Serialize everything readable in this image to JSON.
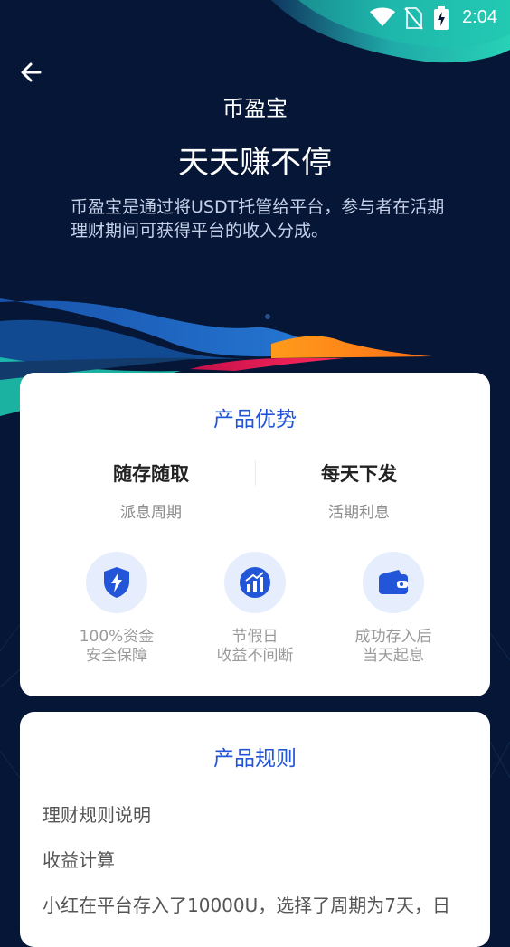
{
  "status_bar": {
    "time": "2:04"
  },
  "header": {
    "app_name": "币盈宝",
    "headline": "天天赚不停",
    "description": "币盈宝是通过将USDT托管给平台，参与者在活期理财期间可获得平台的收入分成。"
  },
  "advantages": {
    "title": "产品优势",
    "features": [
      {
        "title": "随存随取",
        "subtitle": "派息周期"
      },
      {
        "title": "每天下发",
        "subtitle": "活期利息"
      }
    ],
    "icons": [
      {
        "icon": "shield-lightning-icon",
        "line1": "100%资金",
        "line2": "安全保障"
      },
      {
        "icon": "growth-chart-icon",
        "line1": "节假日",
        "line2": "收益不间断"
      },
      {
        "icon": "wallet-icon",
        "line1": "成功存入后",
        "line2": "当天起息"
      }
    ]
  },
  "rules": {
    "title": "产品规则",
    "items": [
      "理财规则说明",
      "收益计算",
      "小红在平台存入了10000U，选择了周期为7天，日"
    ]
  },
  "colors": {
    "accent": "#2255d8",
    "background": "#061637",
    "teal": "#1fc3ae"
  }
}
